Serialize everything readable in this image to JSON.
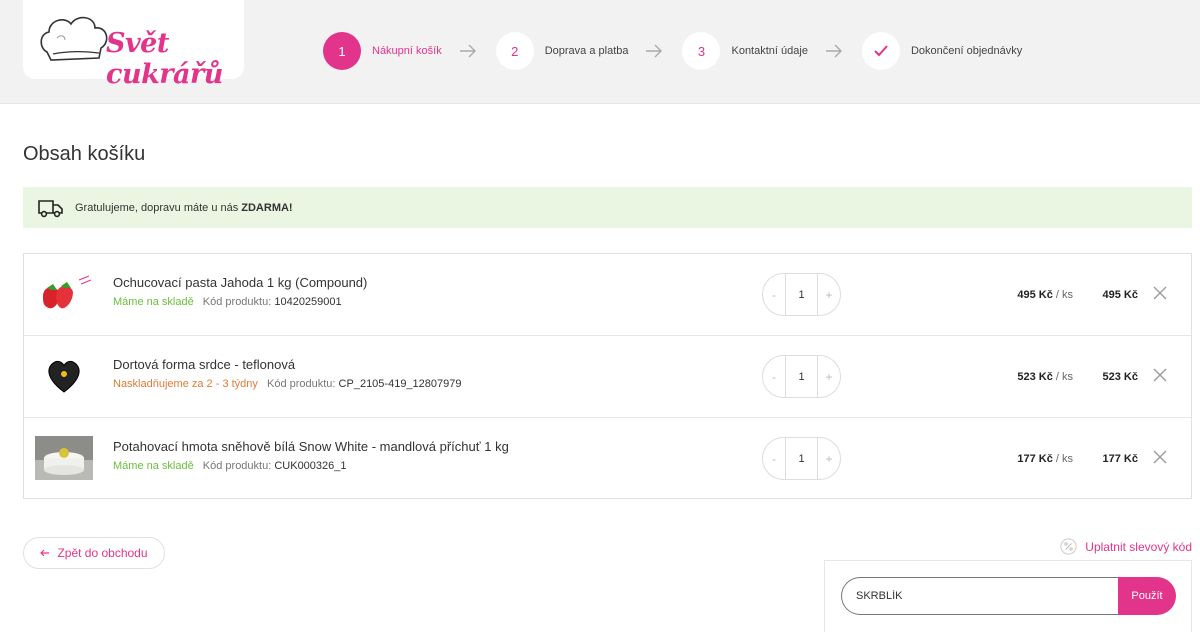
{
  "brand": {
    "name": "Svět cukrářů",
    "accent": "#e2348a"
  },
  "steps": [
    {
      "number": "1",
      "label": "Nákupní košík",
      "active": true
    },
    {
      "number": "2",
      "label": "Doprava a platba",
      "active": false
    },
    {
      "number": "3",
      "label": "Kontaktní údaje",
      "active": false
    },
    {
      "icon": "check-icon",
      "label": "Dokončení objednávky",
      "active": false
    }
  ],
  "page_title": "Obsah košíku",
  "notice": {
    "text": "Gratulujeme, dopravu máte u nás",
    "bold": "ZDARMA!",
    "icon": "truck-icon",
    "bg": "#eaf6e2"
  },
  "cart": {
    "items": [
      {
        "name": "Ochucovací pasta Jahoda 1 kg (Compound)",
        "stock": "Máme na skladě",
        "stock_status": "ok",
        "code_label": "Kód produktu:",
        "code": "10420259001",
        "qty": "1",
        "unit_price": "495 Kč",
        "per": "/ ks",
        "total": "495 Kč"
      },
      {
        "name": "Dortová forma srdce - teflonová",
        "stock": "Naskladňujeme za 2 - 3 týdny",
        "stock_status": "wait",
        "code_label": "Kód produktu:",
        "code": "CP_2105-419_12807979",
        "qty": "1",
        "unit_price": "523 Kč",
        "per": "/ ks",
        "total": "523 Kč"
      },
      {
        "name": "Potahovací hmota sněhově bílá Snow White - mandlová příchuť 1 kg",
        "stock": "Máme na skladě",
        "stock_status": "ok",
        "code_label": "Kód produktu:",
        "code": "CUK000326_1",
        "qty": "1",
        "unit_price": "177 Kč",
        "per": "/ ks",
        "total": "177 Kč"
      }
    ],
    "minus": "-",
    "plus": "+"
  },
  "back_button": "Zpět do obchodu",
  "coupon": {
    "link": "Uplatnit slevový kód",
    "value": "SKRBLÍK",
    "button": "Použít"
  }
}
